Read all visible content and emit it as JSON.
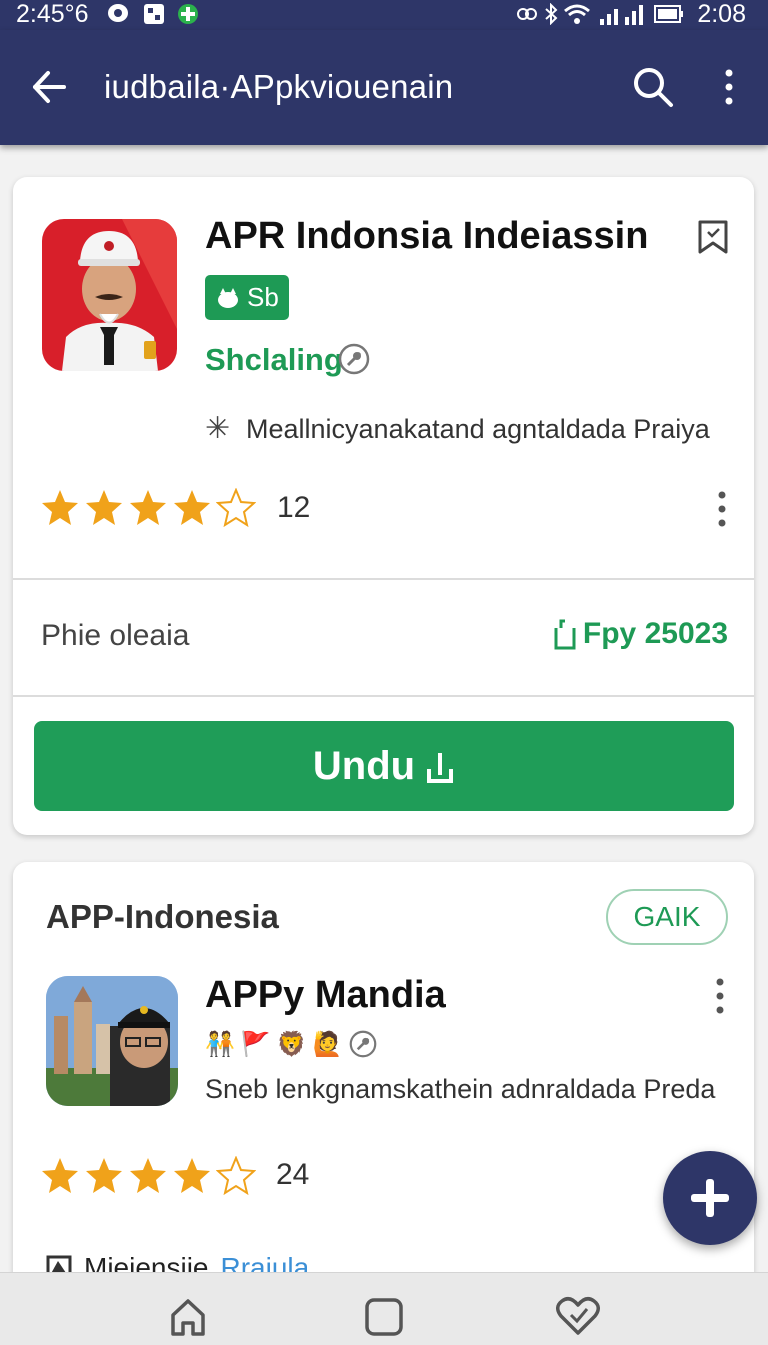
{
  "status_bar": {
    "time_left": "2:45°6",
    "time_right": "2:08",
    "left_icons": [
      "chat-bubble-icon",
      "grid-app-icon",
      "plus-circle-icon"
    ],
    "right_icons": [
      "vibrate-icon",
      "bluetooth-icon",
      "wifi-icon",
      "signal-icon",
      "battery-icon"
    ]
  },
  "app_bar": {
    "title": "iudbaila·APpkviouenain",
    "icons": [
      "back-arrow-icon",
      "search-icon",
      "more-vertical-icon"
    ]
  },
  "card1": {
    "title": "APR Indonsia Indeiassin",
    "badge_label": "Sb",
    "developer": "Shclaling",
    "description": "Meallnicyanakatand agntaldada Praiya",
    "rating": 4,
    "rating_max": 5,
    "review_count": "12",
    "info_label": "Phie oleaia",
    "info_value": "Fpy 25023",
    "download_label": "Undu",
    "colors": {
      "accent_green": "#1f9d58",
      "badge_green": "#1e9a55",
      "star": "#f0a21a"
    }
  },
  "card2": {
    "section_title": "APP-Indonesia",
    "pill_label": "GAIK",
    "title": "APPy Mandia",
    "description": "Sneb lenkgnamskathein adnraldada Preda",
    "rating": 4,
    "rating_max": 5,
    "review_count": "24",
    "footer_text": "Mieiensiie",
    "footer_link": "Rraiula"
  },
  "theme": {
    "primary": "#2e3668"
  },
  "nav_bar": {
    "icons": [
      "home-icon",
      "recents-square-icon",
      "heart-check-icon"
    ]
  }
}
